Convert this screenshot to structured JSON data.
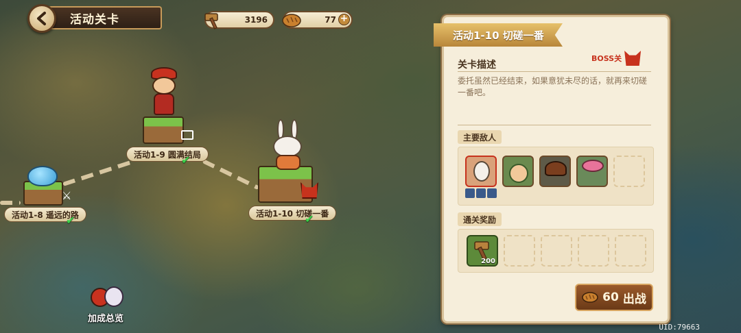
{
  "header": {
    "title": "活动关卡"
  },
  "resources": [
    {
      "icon": "hammer-icon",
      "value": "3196"
    },
    {
      "icon": "bread-icon",
      "value": "77"
    }
  ],
  "map": {
    "nodes": [
      {
        "label": "活动1-8  遥远的路",
        "cleared": true
      },
      {
        "label": "活动1-9  圆满结局",
        "cleared": true
      },
      {
        "label": "活动1-10  切磋一番",
        "cleared": true
      }
    ],
    "bonus_label": "加成总览"
  },
  "stage_panel": {
    "title": "活动1-10  切磋一番",
    "desc_heading": "关卡描述",
    "boss_tag": "BOSS关",
    "description": "委托虽然已经结束，如果意犹未尽的话，就再来切磋一番吧。",
    "enemies_heading": "主要敌人",
    "enemies": [
      {
        "name": "rabbit-boss",
        "boss": true,
        "bg": "#d9a27a"
      },
      {
        "name": "green-sprout",
        "boss": false,
        "bg": "#6a8a4e"
      },
      {
        "name": "mushroom",
        "boss": false,
        "bg": "#5e5a48"
      },
      {
        "name": "pink-flower-goblin",
        "boss": false,
        "bg": "#6a8a5a"
      }
    ],
    "rewards_heading": "通关奖励",
    "rewards": [
      {
        "icon": "hammer-icon",
        "count": "200"
      }
    ],
    "fight_cost": "60",
    "fight_label": "出战"
  },
  "uid": "UID:79663",
  "colors": {
    "accent": "#c7321d",
    "check": "#3cd24b",
    "panel": "#f6eedb"
  }
}
